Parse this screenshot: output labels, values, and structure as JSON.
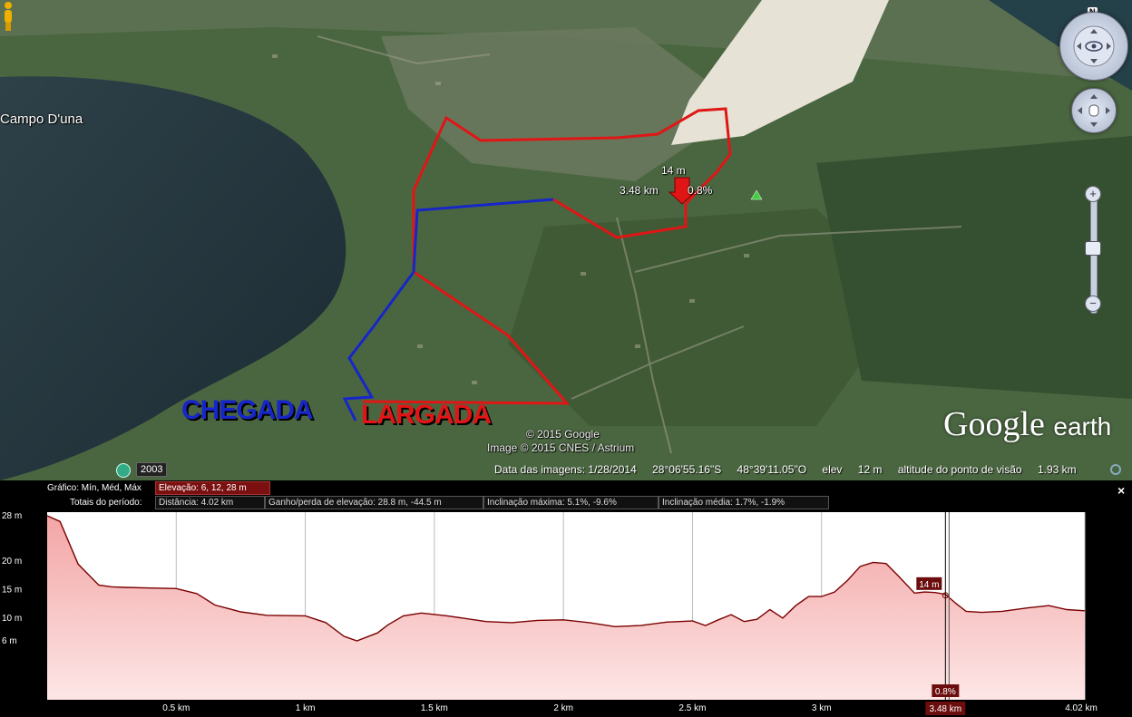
{
  "map": {
    "place_label": "Campo D'una",
    "chegada_label": "CHEGADA",
    "largada_label": "LARGADA",
    "marker": {
      "elevation": "14 m",
      "distance": "3.48 km",
      "slope": "0.8%"
    },
    "copyright": "© 2015 Google",
    "imagery_credit": "Image © 2015 CNES / Astrium",
    "logo": {
      "word1": "Google",
      "word2": "earth"
    },
    "historical_year": "2003",
    "north": "N",
    "colors": {
      "route_red": "#e01616",
      "route_blue": "#1726c8"
    }
  },
  "status_bar": {
    "image_date": "Data das imagens: 1/28/2014",
    "lat": "28°06'55.16\"S",
    "lon": "48°39'11.05\"O",
    "elev_label": "elev",
    "elev_value": "12 m",
    "eye_label": "altitude do ponto de visão",
    "eye_value": "1.93 km"
  },
  "profile": {
    "graph_label": "Gráfico: Mín, Méd, Máx",
    "elevation_summary": "Elevação: 6, 12, 28 m",
    "totals_label": "Totais do período:",
    "distance": "Distância: 4.02 km",
    "gain_loss": "Ganho/perda de elevação: 28.8 m, -44.5 m",
    "max_slope": "Inclinação máxima: 5.1%, -9.6%",
    "avg_slope": "Inclinação média: 1.7%, -1.9%",
    "close": "×",
    "y_ticks": [
      "28 m",
      "20 m",
      "15 m",
      "10 m",
      "6 m"
    ],
    "x_ticks": [
      "0.5 km",
      "1 km",
      "1.5 km",
      "2 km",
      "2.5 km",
      "3 km",
      "4.02 km"
    ],
    "cursor": {
      "distance_label": "3.48 km",
      "elevation_label": "14 m",
      "slope_label": "0.8%",
      "distance": 3.48,
      "elevation": 14
    }
  },
  "chart_data": {
    "type": "area",
    "title": "",
    "xlabel": "",
    "ylabel": "",
    "xlim": [
      0,
      4.02
    ],
    "ylim": [
      0,
      28
    ],
    "series": [
      {
        "values_x": [
          0,
          0.05,
          0.12,
          0.2,
          0.25,
          0.3,
          0.4,
          0.5,
          0.58,
          0.65,
          0.75,
          0.85,
          1.0,
          1.08,
          1.15,
          1.2,
          1.28,
          1.32,
          1.38,
          1.45,
          1.55,
          1.7,
          1.8,
          1.9,
          2.0,
          2.1,
          2.2,
          2.3,
          2.4,
          2.5,
          2.55,
          2.6,
          2.65,
          2.7,
          2.75,
          2.8,
          2.85,
          2.9,
          2.95,
          3.0,
          3.05,
          3.1,
          3.15,
          3.2,
          3.25,
          3.3,
          3.36,
          3.4,
          3.44,
          3.48,
          3.52,
          3.56,
          3.62,
          3.7,
          3.8,
          3.88,
          3.95,
          4.02
        ],
        "values_y": [
          28,
          27,
          19.5,
          15.8,
          15.5,
          15.4,
          15.3,
          15.2,
          14.3,
          12.3,
          11.1,
          10.5,
          10.4,
          9.2,
          6.8,
          6.0,
          7.4,
          8.8,
          10.4,
          10.9,
          10.4,
          9.4,
          9.2,
          9.6,
          9.7,
          9.2,
          8.5,
          8.7,
          9.3,
          9.5,
          8.7,
          9.7,
          10.6,
          9.4,
          9.8,
          11.5,
          10.0,
          12.2,
          13.8,
          13.8,
          14.6,
          16.6,
          19.1,
          19.8,
          19.6,
          17.3,
          14.4,
          14.6,
          14.5,
          14.2,
          12.6,
          11.2,
          11.0,
          11.2,
          11.8,
          12.2,
          11.5,
          11.3
        ]
      }
    ]
  }
}
